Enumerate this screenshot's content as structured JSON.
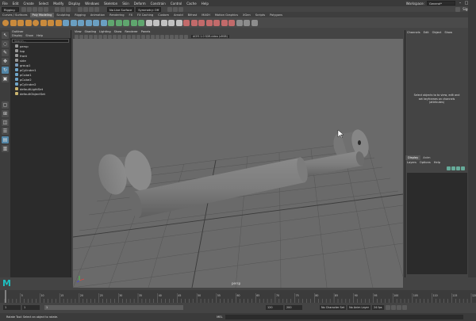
{
  "menubar": {
    "items": [
      "File",
      "Edit",
      "Create",
      "Select",
      "Modify",
      "Display",
      "Windows",
      "Skeleton",
      "Skin",
      "Deform",
      "Constrain",
      "Control",
      "Cache",
      "Help"
    ],
    "workspace_label": "Workspace:",
    "workspace_value": "General*"
  },
  "statusline": {
    "menuset": "Rigging",
    "live_surface": "No Live Surface",
    "symmetry": "Symmetry: Off",
    "sign_in": "Sign In"
  },
  "shelf_tabs": [
    "Curves / Surfaces",
    "Poly Modeling",
    "Sculpting",
    "Rigging",
    "Animation",
    "Rendering",
    "FX",
    "FX Caching",
    "Custom",
    "Arnold",
    "Bifrost",
    "MASH",
    "Motion Graphics",
    "XGen",
    "Scripts",
    "Polygons"
  ],
  "active_shelf_tab": 1,
  "outliner": {
    "title": "Outliner",
    "menu": [
      "Display",
      "Show",
      "Help"
    ],
    "search_placeholder": "Search...",
    "items": [
      {
        "label": "persp",
        "type": "camera"
      },
      {
        "label": "top",
        "type": "camera"
      },
      {
        "label": "front",
        "type": "camera"
      },
      {
        "label": "side",
        "type": "camera"
      },
      {
        "label": "group1",
        "type": "group"
      },
      {
        "label": "pCylinder1",
        "type": "mesh"
      },
      {
        "label": "pCube1",
        "type": "mesh"
      },
      {
        "label": "pCube2",
        "type": "mesh"
      },
      {
        "label": "pCylinder2",
        "type": "mesh"
      },
      {
        "label": "defaultLightSet",
        "type": "set"
      },
      {
        "label": "defaultObjectSet",
        "type": "set"
      }
    ]
  },
  "viewport": {
    "menu": [
      "View",
      "Shading",
      "Lighting",
      "Show",
      "Renderer",
      "Panels"
    ],
    "colorspace": "ACES 1.0 SDR-video (sRGB)",
    "camera_label": "persp"
  },
  "channelbox": {
    "menu": [
      "Channels",
      "Edit",
      "Object",
      "Show"
    ],
    "message": "Select objects to to view, edit and set keyframes on channels (attributes)"
  },
  "layers": {
    "tabs": [
      "Display",
      "Anim"
    ],
    "active_tab": 0,
    "menu": [
      "Layers",
      "Options",
      "Help"
    ]
  },
  "timeline": {
    "ticks": [
      "5",
      "10",
      "15",
      "20",
      "25",
      "30",
      "35",
      "40",
      "45",
      "50",
      "55",
      "60",
      "65",
      "70",
      "75",
      "80",
      "85",
      "90",
      "95",
      "100",
      "105",
      "110",
      "115",
      "120"
    ],
    "start": "1",
    "end": "120",
    "range_start": "1",
    "range_end": "120",
    "range_end2": "200",
    "character_set": "No Character Set",
    "anim_layer": "No Anim Layer",
    "fps": "24 fps"
  },
  "command": {
    "help_text": "Rotate Tool: Select an object to rotate.",
    "mel_label": "MEL"
  },
  "colors": {
    "accent": "#5285a6",
    "viewport_bg": "#6a6a6a",
    "grid": "#4f4f4f",
    "mesh": "#7c7c7c"
  }
}
